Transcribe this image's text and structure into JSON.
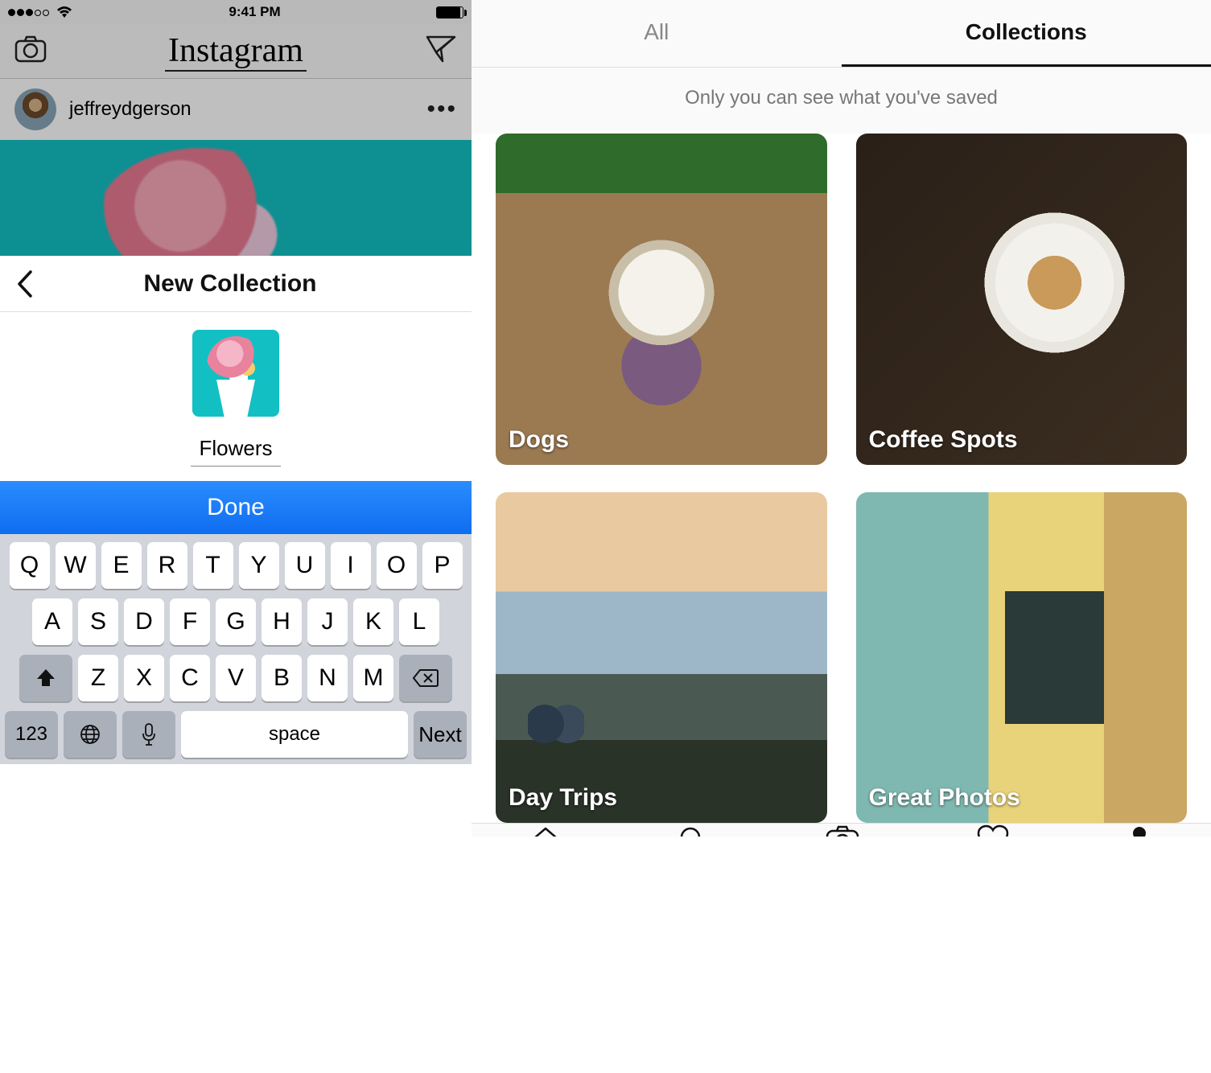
{
  "left": {
    "status": {
      "carrier_dots": 5,
      "time": "9:41 PM"
    },
    "app_name": "Instagram",
    "post": {
      "username": "jeffreydgerson"
    },
    "sheet": {
      "title": "New Collection",
      "input_value": "Flowers",
      "done_label": "Done"
    },
    "keyboard": {
      "row1": [
        "Q",
        "W",
        "E",
        "R",
        "T",
        "Y",
        "U",
        "I",
        "O",
        "P"
      ],
      "row2": [
        "A",
        "S",
        "D",
        "F",
        "G",
        "H",
        "J",
        "K",
        "L"
      ],
      "row3": [
        "Z",
        "X",
        "C",
        "V",
        "B",
        "N",
        "M"
      ],
      "numbers_key": "123",
      "space_key": "space",
      "next_key": "Next"
    }
  },
  "right": {
    "tabs": {
      "all": "All",
      "collections": "Collections",
      "active": "collections"
    },
    "notice": "Only you can see what you've saved",
    "collections": [
      {
        "name": "Dogs"
      },
      {
        "name": "Coffee Spots"
      },
      {
        "name": "Day Trips"
      },
      {
        "name": "Great Photos"
      }
    ],
    "tabbar_icons": [
      "home",
      "search",
      "camera",
      "activity",
      "profile"
    ]
  }
}
